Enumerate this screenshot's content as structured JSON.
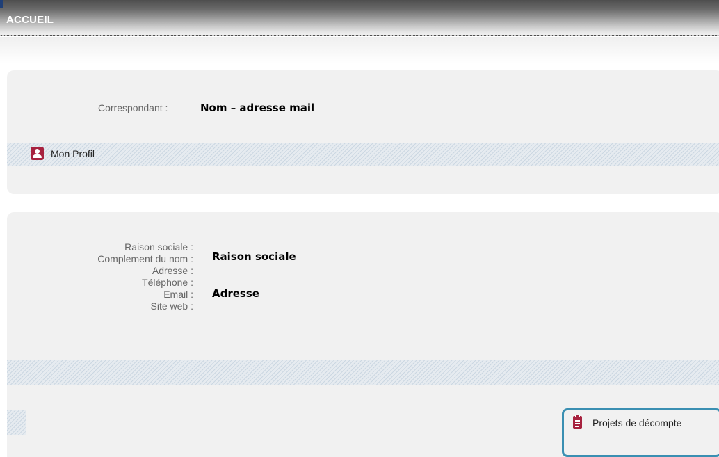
{
  "header": {
    "title": "ACCUEIL"
  },
  "correspondant": {
    "label": "Correspondant :",
    "value": "Nom – adresse mail"
  },
  "profile": {
    "label": "Mon Profil",
    "icon": "user-icon"
  },
  "company": {
    "labels": [
      "Raison sociale :",
      "Complement du nom :",
      "Adresse :",
      "Téléphone :",
      "Email :",
      "Site web :"
    ],
    "raison_sociale": "Raison sociale",
    "adresse": "Adresse"
  },
  "projets": {
    "label": "Projets de décompte",
    "icon": "clipboard-icon"
  },
  "colors": {
    "accent": "#a7223f",
    "highlight_border": "#3a8fb2"
  }
}
